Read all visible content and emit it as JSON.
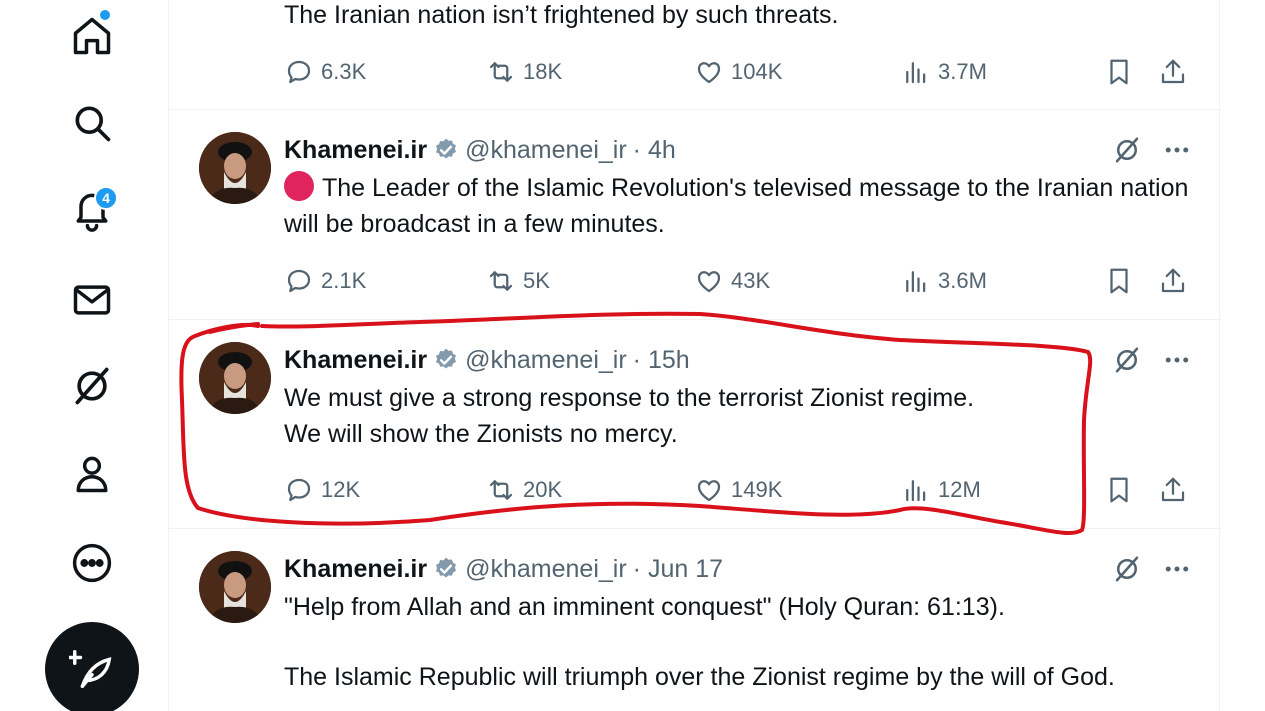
{
  "sidebar": {
    "items": [
      {
        "icon": "home-icon",
        "has_dot": true
      },
      {
        "icon": "search-icon"
      },
      {
        "icon": "bell-icon",
        "badge": "4"
      },
      {
        "icon": "mail-icon"
      },
      {
        "icon": "grok-icon"
      },
      {
        "icon": "profile-icon"
      },
      {
        "icon": "more-icon"
      }
    ],
    "compose_icon": "feather-plus-icon"
  },
  "posts": [
    {
      "text": "The Iranian nation isn’t frightened by such threats.",
      "stats": {
        "replies": "6.3K",
        "reposts": "18K",
        "likes": "104K",
        "views": "3.7M"
      }
    },
    {
      "author": "Khamenei.ir",
      "handle": "@khamenei_ir",
      "time": "· 4h",
      "text": "The Leader of the Islamic Revolution's televised message to the Iranian nation will be broadcast in a few minutes.",
      "stats": {
        "replies": "2.1K",
        "reposts": "5K",
        "likes": "43K",
        "views": "3.6M"
      }
    },
    {
      "author": "Khamenei.ir",
      "handle": "@khamenei_ir",
      "time": "· 15h",
      "text_line1": "We must give a strong response to the terrorist Zionist regime.",
      "text_line2": "We will show the Zionists no mercy.",
      "stats": {
        "replies": "12K",
        "reposts": "20K",
        "likes": "149K",
        "views": "12M"
      }
    },
    {
      "author": "Khamenei.ir",
      "handle": "@khamenei_ir",
      "time": "· Jun 17",
      "text_line1": "\"Help from Allah and an imminent conquest\" (Holy Quran: 61:13).",
      "text_line2": "The Islamic Republic will triumph over the Zionist regime by the will of God."
    }
  ],
  "colors": {
    "accent": "#1d9bf0",
    "text": "#0f1419",
    "muted": "#536471",
    "highlight_red": "#d8111b",
    "live_dot": "#e0245e"
  }
}
